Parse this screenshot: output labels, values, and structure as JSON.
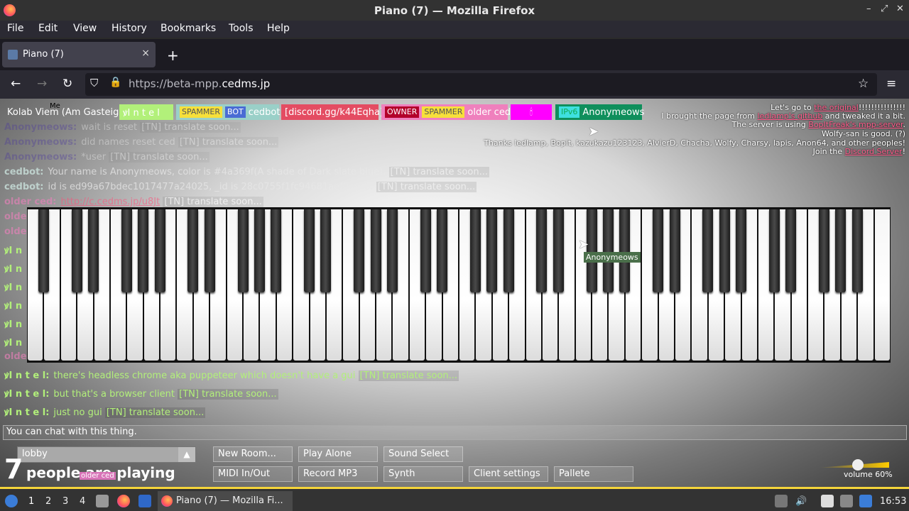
{
  "window": {
    "title": "Piano (7) — Mozilla Firefox"
  },
  "menu": [
    "File",
    "Edit",
    "View",
    "History",
    "Bookmarks",
    "Tools",
    "Help"
  ],
  "tab": {
    "label": "Piano (7)",
    "close": "×",
    "new": "+"
  },
  "nav": {
    "url_prefix": "https://beta-mpp.",
    "url_domain": "cedms.jp"
  },
  "users": {
    "me_marker": "Me",
    "me": "Kolab Viem (Am Gasteig)",
    "intel": "ꝟI n t e l",
    "cedbot_tags": [
      "SPAMMER",
      "BOT"
    ],
    "cedbot": "cedbot",
    "discord": "[discord.gg/k44Eqha]",
    "older_tags": [
      "OWNER",
      "SPAMMER"
    ],
    "older": "older ced",
    "emoji_user": "🕯",
    "anon_tag": "IPv6",
    "anon": "Anonymeows"
  },
  "chat": [
    {
      "nick": "Anonymeows:",
      "text": "wait is reset",
      "tn": "[TN] translate soon..."
    },
    {
      "nick": "Anonymeows:",
      "text": "did names reset ced",
      "tn": "[TN] translate soon..."
    },
    {
      "nick": "Anonymeows:",
      "text": "*user",
      "tn": "[TN] translate soon..."
    },
    {
      "nick": "cedbot:",
      "text": "Your name is Anonymeows, color is #4a369f(A shade of Dark slate blue).",
      "tn": "[TN] translate soon..."
    },
    {
      "nick": "cedbot:",
      "text": "id is ed99a67bdec1017477a24025, _id is 28c0755f1fc94681aef0cce0.",
      "tn": "[TN] translate soon..."
    },
    {
      "nick": "older ced:",
      "text": "http://c.cedms.jp/u8Jt",
      "tn": "[TN] translate soon..."
    },
    {
      "nick": "ꝟI n t e l:",
      "text": "there's headless chrome aka puppeteer which doesn't have a gui",
      "tn": "[TN] translate soon..."
    },
    {
      "nick": "ꝟI n t e l:",
      "text": "but that's a browser client",
      "tn": "[TN] translate soon..."
    },
    {
      "nick": "ꝟI n t e l:",
      "text": "just no gui",
      "tn": "[TN] translate soon..."
    }
  ],
  "side_nicks": [
    "olde",
    "olde",
    "ꝟI n",
    "ꝟI n",
    "ꝟI n",
    "ꝟI n",
    "ꝟI n",
    "ꝟI n",
    "olde"
  ],
  "info": {
    "l1_pre": "Let's go to ",
    "l1_link": "the original",
    "l1_post": "!!!!!!!!!!!!!!!",
    "l2_pre": "I brought the page from ",
    "l2_link": "ledlamp's github",
    "l2_post": " and tweaked it a bit.",
    "l3_pre": "The server is using ",
    "l3_link": "BopItFreak's mpp-server",
    "l3_post": ".",
    "l4": "Wolfy-san is good. (?)",
    "l5": "Thanks ledlamp, Bopit, kazukazu123123, AlvierD, Chacha, Wolfy, Charsy, lapis, Anon64, and other peoples!",
    "l6_pre": "Join the ",
    "l6_link": "Discord Server",
    "l6_post": "!"
  },
  "cursor_label": "Anonymeows",
  "chat_placeholder": "You can chat with this thing.",
  "room": {
    "name": "lobby",
    "arrow": "▲"
  },
  "people": {
    "count": "7",
    "text": "people are playing",
    "overlay": "older ced"
  },
  "buttons": [
    "New Room...",
    "Play Alone",
    "Sound Select",
    "MIDI In/Out",
    "Record MP3",
    "Synth",
    "Client settings",
    "Pallete"
  ],
  "volume": {
    "label": "volume 60%",
    "value": 0.6
  },
  "taskbar": {
    "workspaces": [
      "1",
      "2",
      "3",
      "4"
    ],
    "app": "Piano (7) — Mozilla Fi...",
    "clock": "16:53"
  },
  "colors": {
    "anon": "#4a369f",
    "intel": "#b2f07a",
    "cedbot": "#9ad0c8",
    "discord": "#e44c62",
    "older": "#ef80bd",
    "emoji_bg": "#ff00ff",
    "anon_bar": "#0f8f5c"
  }
}
